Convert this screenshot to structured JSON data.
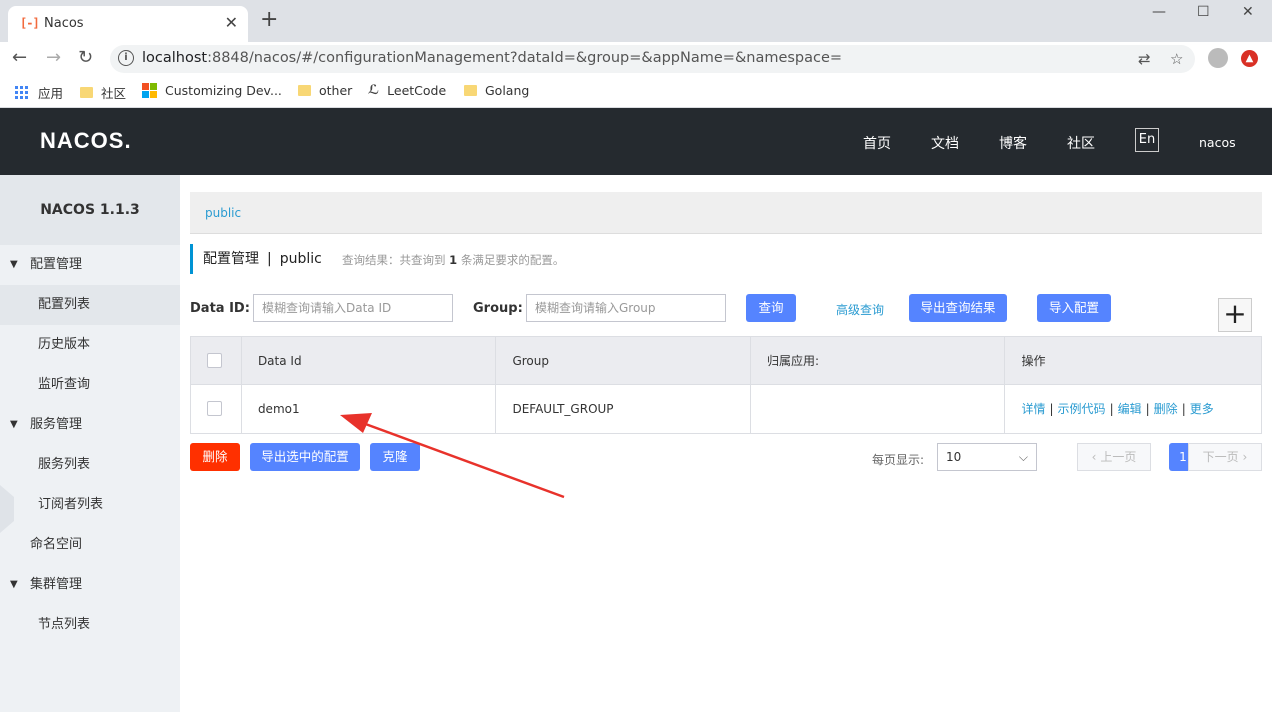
{
  "browser": {
    "tab_title": "Nacos",
    "favicon": "[-]",
    "url_host": "localhost",
    "url_rest": ":8848/nacos/#/configurationManagement?dataId=&group=&appName=&namespace=",
    "bookmarks": [
      {
        "label": "应用",
        "icon": "apps-icon"
      },
      {
        "label": "社区",
        "icon": "folder-icon"
      },
      {
        "label": "Customizing Dev...",
        "icon": "microsoft-icon"
      },
      {
        "label": "other",
        "icon": "folder-icon"
      },
      {
        "label": "LeetCode",
        "icon": "leetcode-icon"
      },
      {
        "label": "Golang",
        "icon": "folder-icon"
      }
    ]
  },
  "header": {
    "logo": "NACOS.",
    "nav": [
      "首页",
      "文档",
      "博客",
      "社区"
    ],
    "lang": "En",
    "user": "nacos"
  },
  "sidebar": {
    "title": "NACOS 1.1.3",
    "items": [
      {
        "label": "配置管理"
      },
      {
        "label": "配置列表"
      },
      {
        "label": "历史版本"
      },
      {
        "label": "监听查询"
      },
      {
        "label": "服务管理"
      },
      {
        "label": "服务列表"
      },
      {
        "label": "订阅者列表"
      },
      {
        "label": "命名空间"
      },
      {
        "label": "集群管理"
      },
      {
        "label": "节点列表"
      }
    ]
  },
  "main": {
    "namespace_tab": "public",
    "page_title": "配置管理",
    "separator": "|",
    "namespace": "public",
    "query_result_prefix": "查询结果：共查询到",
    "query_result_count": "1",
    "query_result_suffix": "条满足要求的配置。",
    "filters": {
      "dataid_label": "Data ID:",
      "dataid_placeholder": "模糊查询请输入Data ID",
      "group_label": "Group:",
      "group_placeholder": "模糊查询请输入Group",
      "search_btn": "查询",
      "advanced": "高级查询",
      "export_results": "导出查询结果",
      "import_config": "导入配置",
      "add": "+"
    },
    "table": {
      "columns": [
        "Data Id",
        "Group",
        "归属应用:",
        "操作"
      ],
      "rows": [
        {
          "data_id": "demo1",
          "group": "DEFAULT_GROUP",
          "app": "",
          "ops": [
            "详情",
            "示例代码",
            "编辑",
            "删除",
            "更多"
          ]
        }
      ]
    },
    "actions": {
      "delete": "删除",
      "export_selected": "导出选中的配置",
      "clone": "克隆"
    },
    "pager": {
      "page_size_label": "每页显示:",
      "page_size": "10",
      "prev": "上一页",
      "current": "1",
      "next": "下一页"
    }
  },
  "colors": {
    "header_bg": "#252a2f",
    "primary": "#5584ff",
    "danger": "#ff3000",
    "link": "#2a9bd1",
    "annotation_arrow": "#e8322b"
  }
}
